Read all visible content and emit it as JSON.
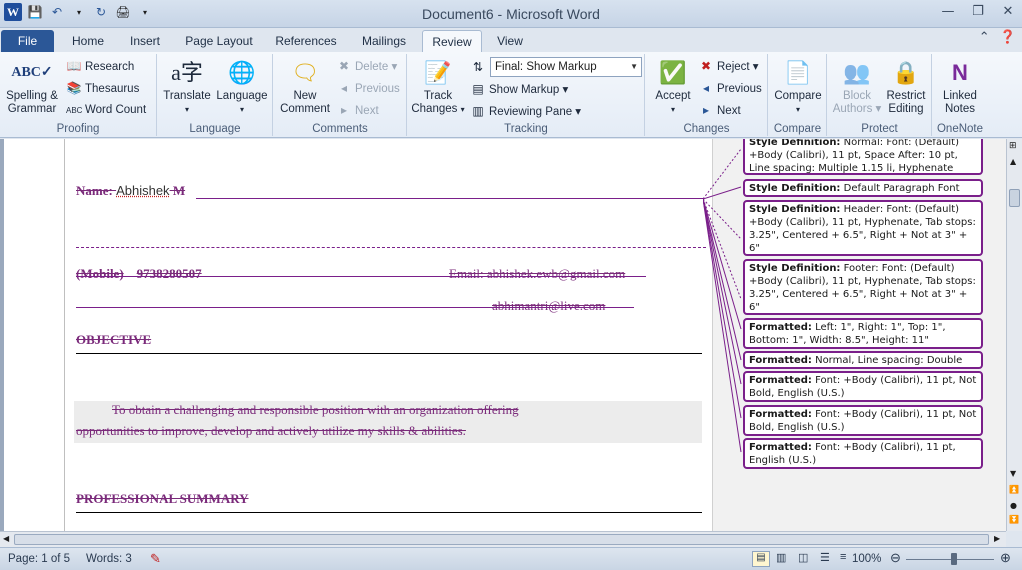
{
  "window": {
    "title": "Document6 - Microsoft Word"
  },
  "tabs": [
    {
      "label": "File"
    },
    {
      "label": "Home"
    },
    {
      "label": "Insert"
    },
    {
      "label": "Page Layout"
    },
    {
      "label": "References"
    },
    {
      "label": "Mailings"
    },
    {
      "label": "Review"
    },
    {
      "label": "View"
    }
  ],
  "ribbon": {
    "proofing": {
      "label": "Proofing",
      "spelling": "Spelling &",
      "grammar": "Grammar",
      "research": "Research",
      "thesaurus": "Thesaurus",
      "word_count": "Word Count"
    },
    "language": {
      "label": "Language",
      "translate": "Translate",
      "language": "Language"
    },
    "comments": {
      "label": "Comments",
      "new_comment_1": "New",
      "new_comment_2": "Comment",
      "delete": "Delete",
      "previous": "Previous",
      "next": "Next"
    },
    "tracking": {
      "label": "Tracking",
      "track_1": "Track",
      "track_2": "Changes",
      "display_value": "Final: Show Markup",
      "show_markup": "Show Markup",
      "reviewing_pane": "Reviewing Pane"
    },
    "changes": {
      "label": "Changes",
      "accept": "Accept",
      "reject": "Reject",
      "previous": "Previous",
      "next": "Next"
    },
    "compare": {
      "label": "Compare",
      "compare": "Compare"
    },
    "protect": {
      "label": "Protect",
      "block_1": "Block",
      "block_2": "Authors",
      "restrict_1": "Restrict",
      "restrict_2": "Editing"
    },
    "onenote": {
      "label": "OneNote",
      "linked_1": "Linked",
      "linked_2": "Notes"
    }
  },
  "document": {
    "name_label": "Name: ",
    "name_value": "Abhishek",
    "name_suffix": " M",
    "mobile_label": "(Mobile)",
    "mobile_value": "9738280507",
    "email_1": "Email: abhishek.ewb@gmail.com",
    "email_2": "abhimantri@live.com",
    "objective_heading": "OBJECTIVE",
    "objective_text_1": "To obtain a challenging and responsible position with an organization offering",
    "objective_text_2": "opportunities to improve, develop and actively utilize my skills & abilities.",
    "summary_heading": "PROFESSIONAL SUMMARY"
  },
  "balloons": [
    {
      "head": "Style Definition:",
      "body": " Normal: Font: (Default) +Body (Calibri), 11 pt, Space After:  10 pt, Line spacing:  Multiple 1.15 li, Hyphenate"
    },
    {
      "head": "Style Definition:",
      "body": " Default Paragraph Font"
    },
    {
      "head": "Style Definition:",
      "body": " Header: Font: (Default) +Body (Calibri), 11 pt, Hyphenate, Tab stops: 3.25\", Centered +  6.5\", Right + Not at  3\" + 6\""
    },
    {
      "head": "Style Definition:",
      "body": " Footer: Font: (Default) +Body (Calibri), 11 pt, Hyphenate, Tab stops: 3.25\", Centered +  6.5\", Right + Not at  3\" + 6\""
    },
    {
      "head": "Formatted:",
      "body": " Left:  1\", Right:  1\", Top:  1\", Bottom:  1\", Width:  8.5\", Height:  11\""
    },
    {
      "head": "Formatted:",
      "body": " Normal, Line spacing:  Double"
    },
    {
      "head": "Formatted:",
      "body": " Font: +Body (Calibri), 11 pt, Not Bold, English (U.S.)"
    },
    {
      "head": "Formatted:",
      "body": " Font: +Body (Calibri), 11 pt, Not Bold, English (U.S.)"
    },
    {
      "head": "Formatted:",
      "body": " Font: +Body (Calibri), 11 pt, English (U.S.)"
    }
  ],
  "status": {
    "page": "Page: 1 of 5",
    "words": "Words: 3",
    "zoom": "100%"
  },
  "colors": {
    "markup": "#7a1f8a",
    "file_tab": "#2b5797"
  }
}
